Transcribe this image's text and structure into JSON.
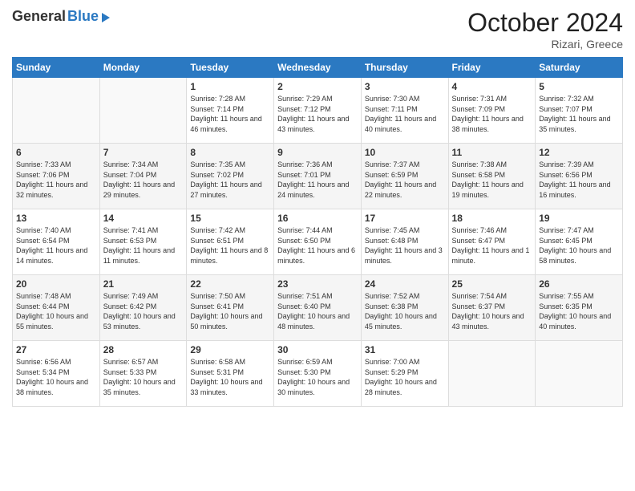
{
  "logo": {
    "general": "General",
    "blue": "Blue"
  },
  "header": {
    "month": "October 2024",
    "location": "Rizari, Greece"
  },
  "days_of_week": [
    "Sunday",
    "Monday",
    "Tuesday",
    "Wednesday",
    "Thursday",
    "Friday",
    "Saturday"
  ],
  "weeks": [
    [
      {
        "day": "",
        "info": ""
      },
      {
        "day": "",
        "info": ""
      },
      {
        "day": "1",
        "info": "Sunrise: 7:28 AM\nSunset: 7:14 PM\nDaylight: 11 hours and 46 minutes."
      },
      {
        "day": "2",
        "info": "Sunrise: 7:29 AM\nSunset: 7:12 PM\nDaylight: 11 hours and 43 minutes."
      },
      {
        "day": "3",
        "info": "Sunrise: 7:30 AM\nSunset: 7:11 PM\nDaylight: 11 hours and 40 minutes."
      },
      {
        "day": "4",
        "info": "Sunrise: 7:31 AM\nSunset: 7:09 PM\nDaylight: 11 hours and 38 minutes."
      },
      {
        "day": "5",
        "info": "Sunrise: 7:32 AM\nSunset: 7:07 PM\nDaylight: 11 hours and 35 minutes."
      }
    ],
    [
      {
        "day": "6",
        "info": "Sunrise: 7:33 AM\nSunset: 7:06 PM\nDaylight: 11 hours and 32 minutes."
      },
      {
        "day": "7",
        "info": "Sunrise: 7:34 AM\nSunset: 7:04 PM\nDaylight: 11 hours and 29 minutes."
      },
      {
        "day": "8",
        "info": "Sunrise: 7:35 AM\nSunset: 7:02 PM\nDaylight: 11 hours and 27 minutes."
      },
      {
        "day": "9",
        "info": "Sunrise: 7:36 AM\nSunset: 7:01 PM\nDaylight: 11 hours and 24 minutes."
      },
      {
        "day": "10",
        "info": "Sunrise: 7:37 AM\nSunset: 6:59 PM\nDaylight: 11 hours and 22 minutes."
      },
      {
        "day": "11",
        "info": "Sunrise: 7:38 AM\nSunset: 6:58 PM\nDaylight: 11 hours and 19 minutes."
      },
      {
        "day": "12",
        "info": "Sunrise: 7:39 AM\nSunset: 6:56 PM\nDaylight: 11 hours and 16 minutes."
      }
    ],
    [
      {
        "day": "13",
        "info": "Sunrise: 7:40 AM\nSunset: 6:54 PM\nDaylight: 11 hours and 14 minutes."
      },
      {
        "day": "14",
        "info": "Sunrise: 7:41 AM\nSunset: 6:53 PM\nDaylight: 11 hours and 11 minutes."
      },
      {
        "day": "15",
        "info": "Sunrise: 7:42 AM\nSunset: 6:51 PM\nDaylight: 11 hours and 8 minutes."
      },
      {
        "day": "16",
        "info": "Sunrise: 7:44 AM\nSunset: 6:50 PM\nDaylight: 11 hours and 6 minutes."
      },
      {
        "day": "17",
        "info": "Sunrise: 7:45 AM\nSunset: 6:48 PM\nDaylight: 11 hours and 3 minutes."
      },
      {
        "day": "18",
        "info": "Sunrise: 7:46 AM\nSunset: 6:47 PM\nDaylight: 11 hours and 1 minute."
      },
      {
        "day": "19",
        "info": "Sunrise: 7:47 AM\nSunset: 6:45 PM\nDaylight: 10 hours and 58 minutes."
      }
    ],
    [
      {
        "day": "20",
        "info": "Sunrise: 7:48 AM\nSunset: 6:44 PM\nDaylight: 10 hours and 55 minutes."
      },
      {
        "day": "21",
        "info": "Sunrise: 7:49 AM\nSunset: 6:42 PM\nDaylight: 10 hours and 53 minutes."
      },
      {
        "day": "22",
        "info": "Sunrise: 7:50 AM\nSunset: 6:41 PM\nDaylight: 10 hours and 50 minutes."
      },
      {
        "day": "23",
        "info": "Sunrise: 7:51 AM\nSunset: 6:40 PM\nDaylight: 10 hours and 48 minutes."
      },
      {
        "day": "24",
        "info": "Sunrise: 7:52 AM\nSunset: 6:38 PM\nDaylight: 10 hours and 45 minutes."
      },
      {
        "day": "25",
        "info": "Sunrise: 7:54 AM\nSunset: 6:37 PM\nDaylight: 10 hours and 43 minutes."
      },
      {
        "day": "26",
        "info": "Sunrise: 7:55 AM\nSunset: 6:35 PM\nDaylight: 10 hours and 40 minutes."
      }
    ],
    [
      {
        "day": "27",
        "info": "Sunrise: 6:56 AM\nSunset: 5:34 PM\nDaylight: 10 hours and 38 minutes."
      },
      {
        "day": "28",
        "info": "Sunrise: 6:57 AM\nSunset: 5:33 PM\nDaylight: 10 hours and 35 minutes."
      },
      {
        "day": "29",
        "info": "Sunrise: 6:58 AM\nSunset: 5:31 PM\nDaylight: 10 hours and 33 minutes."
      },
      {
        "day": "30",
        "info": "Sunrise: 6:59 AM\nSunset: 5:30 PM\nDaylight: 10 hours and 30 minutes."
      },
      {
        "day": "31",
        "info": "Sunrise: 7:00 AM\nSunset: 5:29 PM\nDaylight: 10 hours and 28 minutes."
      },
      {
        "day": "",
        "info": ""
      },
      {
        "day": "",
        "info": ""
      }
    ]
  ]
}
